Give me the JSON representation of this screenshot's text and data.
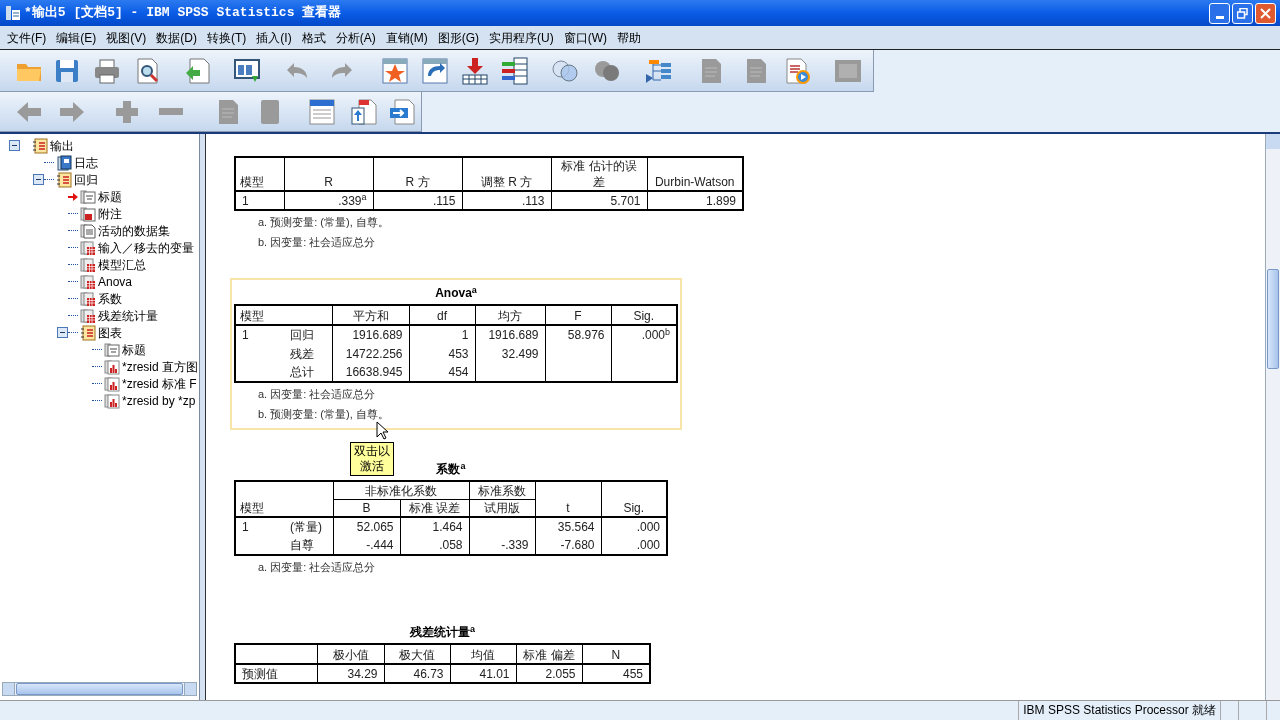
{
  "window": {
    "title": "*输出5 [文档5] - IBM SPSS Statistics 查看器"
  },
  "menu": [
    "文件(F)",
    "编辑(E)",
    "视图(V)",
    "数据(D)",
    "转换(T)",
    "插入(I)",
    "格式",
    "分析(A)",
    "直销(M)",
    "图形(G)",
    "实用程序(U)",
    "窗口(W)",
    "帮助"
  ],
  "outline": [
    {
      "label": "输出",
      "kind": "book",
      "expanded": true,
      "current": false,
      "children": [
        {
          "label": "日志",
          "kind": "log",
          "current": false
        },
        {
          "label": "回归",
          "kind": "book",
          "expanded": true,
          "current": false,
          "children": [
            {
              "label": "标题",
              "kind": "title",
              "current": true
            },
            {
              "label": "附注",
              "kind": "notes",
              "current": false
            },
            {
              "label": "活动的数据集",
              "kind": "text",
              "current": false
            },
            {
              "label": "输入／移去的变量",
              "kind": "table",
              "current": false
            },
            {
              "label": "模型汇总",
              "kind": "table",
              "current": false
            },
            {
              "label": "Anova",
              "kind": "table",
              "current": false
            },
            {
              "label": "系数",
              "kind": "table",
              "current": false
            },
            {
              "label": "残差统计量",
              "kind": "table",
              "current": false
            },
            {
              "label": "图表",
              "kind": "book",
              "expanded": true,
              "current": false,
              "children": [
                {
                  "label": "标题",
                  "kind": "title",
                  "current": false
                },
                {
                  "label": "*zresid 直方图",
                  "kind": "chart",
                  "current": false
                },
                {
                  "label": "*zresid 标准 F",
                  "kind": "chart",
                  "current": false
                },
                {
                  "label": "*zresid by *zp",
                  "kind": "chart",
                  "current": false
                }
              ]
            }
          ]
        }
      ]
    }
  ],
  "tables": [
    {
      "selected": false,
      "header_rows": [
        [
          {
            "text": "模型",
            "kind": "label"
          },
          {
            "text": "R"
          },
          {
            "text": "R 方"
          },
          {
            "text": "调整 R 方"
          },
          {
            "text": "标准 估计的误差"
          },
          {
            "text": "Durbin-Watson"
          }
        ]
      ],
      "rows": [
        [
          "1",
          ".339$^{a}$",
          ".115",
          ".113",
          "5.701",
          "1.899"
        ]
      ],
      "footnotes": [
        "a. 预测变量: (常量), 自尊。",
        "b. 因变量: 社会适应总分"
      ]
    },
    {
      "selected": true,
      "title": "Anova$^{a}$",
      "header_rows": [
        [
          {
            "text": "模型",
            "kind": "label",
            "colspan": 2
          },
          {
            "text": "平方和"
          },
          {
            "text": "df"
          },
          {
            "text": "均方"
          },
          {
            "text": "F"
          },
          {
            "text": "Sig."
          }
        ]
      ],
      "rows": [
        [
          "1",
          "回归",
          "1916.689",
          "1",
          "1916.689",
          "58.976",
          ".000$^{b}$"
        ],
        [
          "",
          "残差",
          "14722.256",
          "453",
          "32.499",
          "",
          ""
        ],
        [
          "",
          "总计",
          "16638.945",
          "454",
          "",
          "",
          ""
        ]
      ],
      "footnotes": [
        "a. 因变量: 社会适应总分",
        "b. 预测变量: (常量), 自尊。"
      ]
    },
    {
      "selected": false,
      "title": "系数$^{a}$",
      "header_rows": [
        [
          {
            "text": "模型",
            "kind": "label",
            "colspan": 2,
            "rowspan": 2
          },
          {
            "text": "非标准化系数",
            "colspan": 2
          },
          {
            "text": "标准系数"
          },
          {
            "text": "t",
            "rowspan": 2
          },
          {
            "text": "Sig.",
            "rowspan": 2
          }
        ],
        [
          {
            "text": "B"
          },
          {
            "text": "标准 误差"
          },
          {
            "text": "试用版"
          }
        ]
      ],
      "rows": [
        [
          "1",
          "(常量)",
          "52.065",
          "1.464",
          "",
          "35.564",
          ".000"
        ],
        [
          "",
          "自尊",
          "-.444",
          ".058",
          "-.339",
          "-7.680",
          ".000"
        ]
      ],
      "footnotes": [
        "a. 因变量: 社会适应总分"
      ]
    },
    {
      "selected": false,
      "title": "残差统计量$^{a}$",
      "header_rows": [
        [
          {
            "text": "",
            "kind": "label"
          },
          {
            "text": "极小值"
          },
          {
            "text": "极大值"
          },
          {
            "text": "均值"
          },
          {
            "text": "标准 偏差"
          },
          {
            "text": "N"
          }
        ]
      ],
      "rows": [
        [
          "预测值",
          "34.29",
          "46.73",
          "41.01",
          "2.055",
          "455"
        ]
      ]
    }
  ],
  "tooltip": "双击以激活",
  "status_bar": "IBM SPSS Statistics Processor 就绪"
}
